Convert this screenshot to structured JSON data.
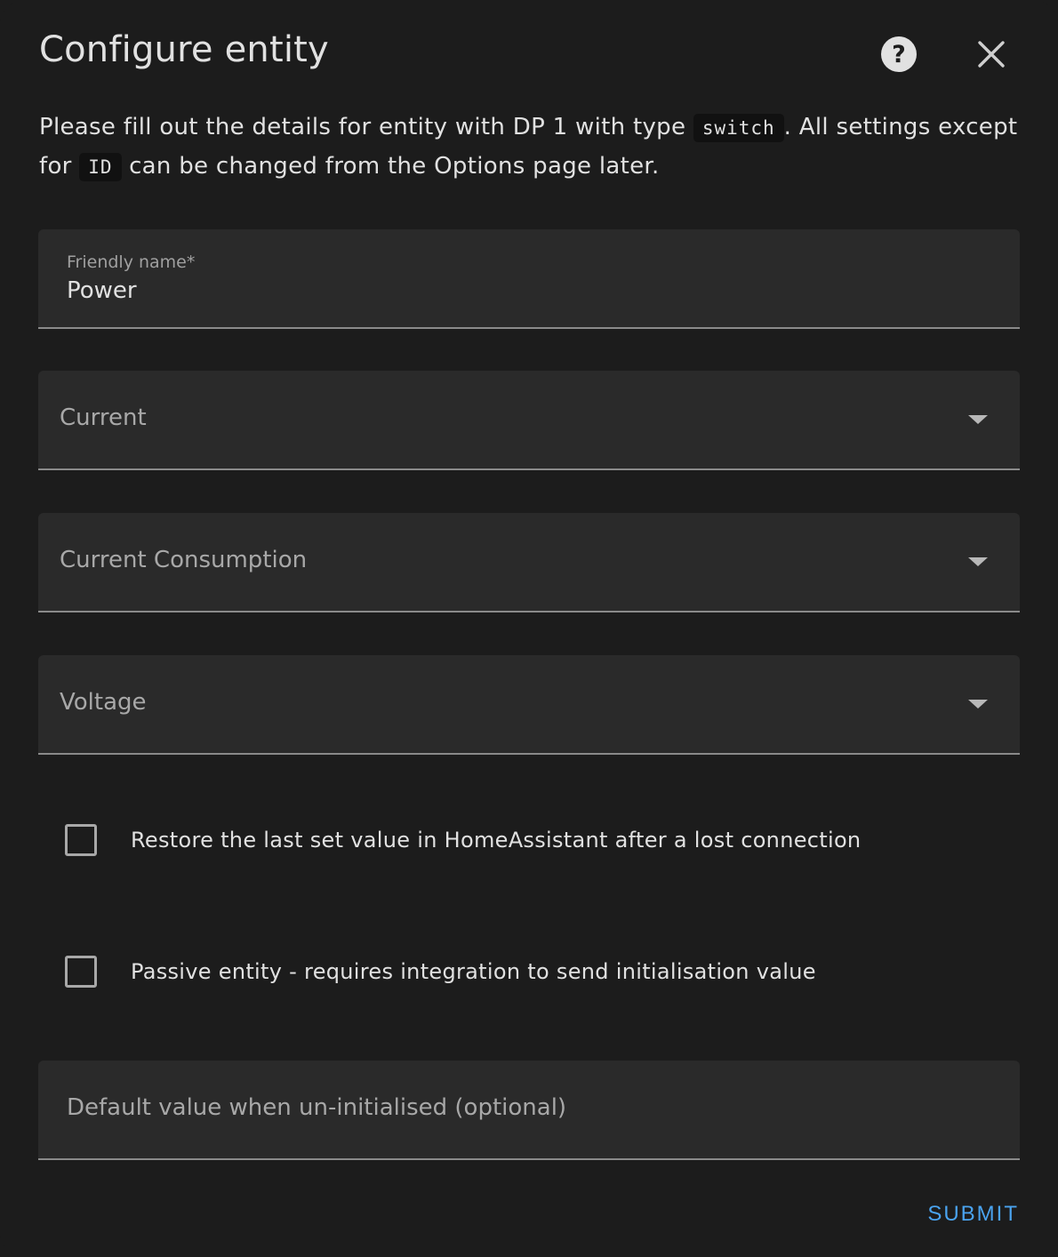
{
  "dialog": {
    "title": "Configure entity",
    "help_icon": "help-circle-icon",
    "close_icon": "close-icon"
  },
  "description": {
    "part1": "Please fill out the details for entity with DP 1 with type ",
    "code1": "switch",
    "part2": ". All settings except for ",
    "code2": "ID",
    "part3": " can be changed from the Options page later."
  },
  "fields": {
    "friendly_name": {
      "label": "Friendly name*",
      "value": "Power"
    },
    "current": {
      "placeholder": "Current"
    },
    "current_consumption": {
      "placeholder": "Current Consumption"
    },
    "voltage": {
      "placeholder": "Voltage"
    },
    "restore_on_reconnect": {
      "label": "Restore the last set value in HomeAssistant after a lost connection",
      "checked": false
    },
    "passive_entity": {
      "label": "Passive entity - requires integration to send initialisation value",
      "checked": false
    },
    "default_value": {
      "placeholder": "Default value when un-initialised (optional)"
    }
  },
  "actions": {
    "submit_label": "SUBMIT"
  },
  "colors": {
    "background": "#1c1c1c",
    "field_background": "#2a2a2a",
    "accent": "#4aa3ef"
  }
}
